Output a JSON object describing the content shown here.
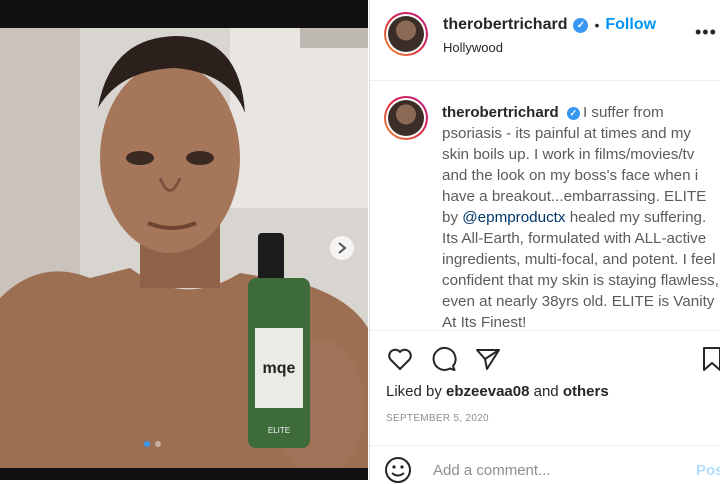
{
  "post": {
    "username": "therobertrichard",
    "verified_icon": "verified-badge-icon",
    "follow_label": "Follow",
    "separator": "•",
    "location": "Hollywood",
    "more_icon": "more-options-icon",
    "more_label": "•••",
    "caption_before": "I suffer from psoriasis - its painful at times and my skin boils up. I work in films/movies/tv and the look on my boss's face when i have a breakout...embarrassing. ELITE by ",
    "caption_mention": "@epmproductx",
    "caption_after": " healed my suffering. Its All-Earth, formulated with ALL-active ingredients, multi-focal, and potent. I feel confident that my skin is staying flawless, even at nearly 38yrs old. ELITE is Vanity At Its Finest!",
    "liked_by_prefix": "Liked by ",
    "liked_by_user": "ebzeevaa08",
    "liked_by_mid": " and ",
    "liked_by_others": "others",
    "date": "SEPTEMBER 5, 2020",
    "comment_placeholder": "Add a comment...",
    "post_label": "Post",
    "bottle_label": "mqe",
    "bottle_brand": "ELITE"
  },
  "carousel": {
    "total": 2,
    "active": 1
  },
  "colors": {
    "accent": "#0095f6",
    "verified": "#3897f0",
    "text": "#262626",
    "muted": "#8e8e8e"
  }
}
